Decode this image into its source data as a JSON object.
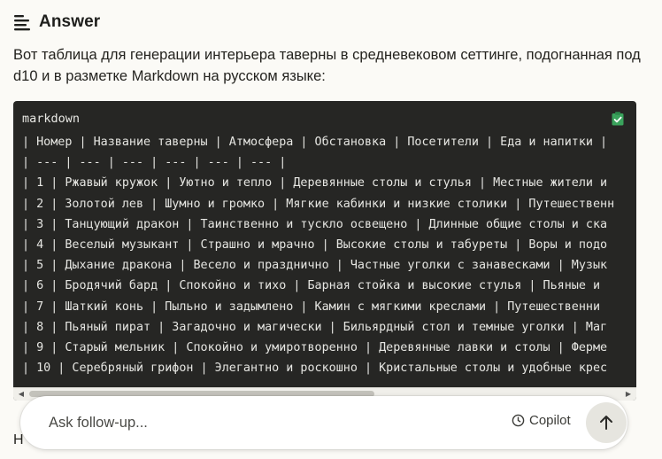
{
  "header": {
    "title": "Answer",
    "icon": "answer-lines-icon"
  },
  "intro_text": "Вот таблица для генерации интерьера таверны в средневековом сеттинге, подогнанная под d10 и в разметке Markdown на русском языке:",
  "code_block": {
    "language": "markdown",
    "copy_icon": "clipboard-check-icon",
    "lines": [
      "| Номер | Название таверны | Атмосфера | Обстановка | Посетители | Еда и напитки |",
      "| --- | --- | --- | --- | --- | --- |",
      "| 1 | Ржавый кружок | Уютно и тепло | Деревянные столы и стулья | Местные жители и",
      "| 2 | Золотой лев | Шумно и громко | Мягкие кабинки и низкие столики | Путешественн",
      "| 3 | Танцующий дракон | Таинственно и тускло освещено | Длинные общие столы и ска",
      "| 4 | Веселый музыкант | Страшно и мрачно | Высокие столы и табуреты | Воры и подо",
      "| 5 | Дыхание дракона | Весело и празднично | Частные уголки с занавесками | Музык",
      "| 6 | Бродячий бард | Спокойно и тихо | Барная стойка и высокие стулья | Пьяные и",
      "| 7 | Шаткий конь | Пыльно и задымлено | Камин с мягкими креслами | Путешественни",
      "| 8 | Пьяный пират | Загадочно и магически | Бильярдный стол и темные уголки | Маг",
      "| 9 | Старый мельник | Спокойно и умиротворенно | Деревянные лавки и столы | Ферме",
      "| 10 | Серебряный грифон | Элегантно и роскошно | Кристальные столы и удобные крес"
    ]
  },
  "ask_bar": {
    "placeholder": "Ask follow-up...",
    "copilot_label": "Copilot",
    "copilot_icon": "clock-icon",
    "send_icon": "arrow-up-icon"
  },
  "partial_text": "Н",
  "colors": {
    "page_bg": "#fbfaf6",
    "code_bg": "#262624",
    "copy_icon_green": "#3aa35c",
    "send_bg": "#e6e5df"
  }
}
